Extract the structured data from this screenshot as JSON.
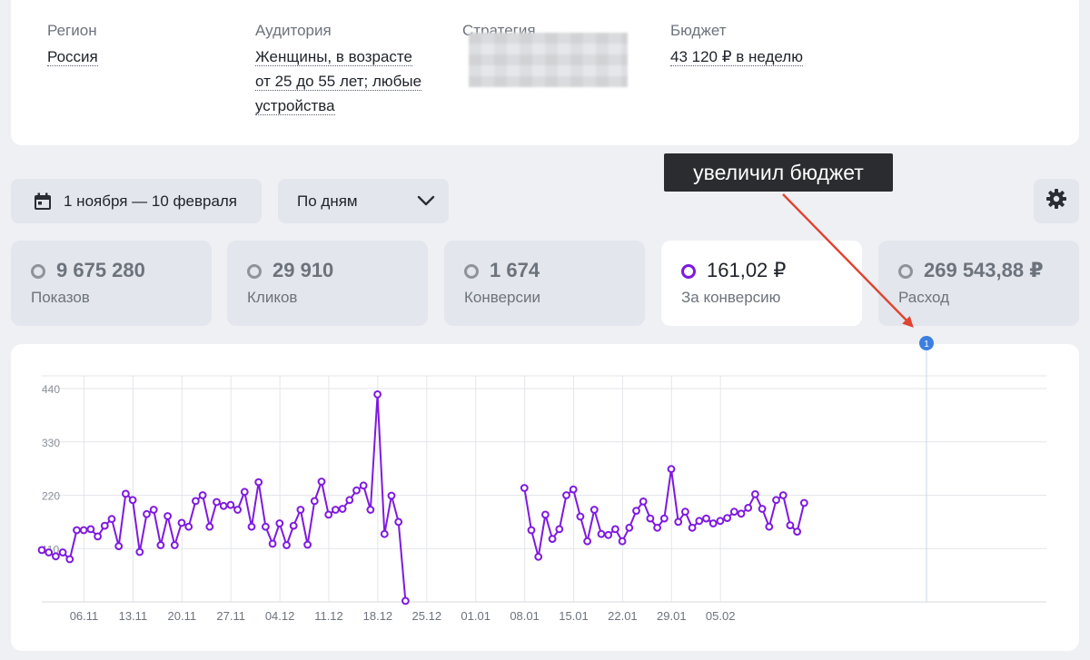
{
  "summary": {
    "region": {
      "label": "Регион",
      "value": "Россия"
    },
    "audience": {
      "label": "Аудитория",
      "lines": [
        "Женщины, в возрасте",
        "от 25 до 55 лет; любые",
        "устройства"
      ]
    },
    "strategy": {
      "label": "Стратегия"
    },
    "budget": {
      "label": "Бюджет",
      "value": "43 120 ₽ в неделю"
    }
  },
  "controls": {
    "period_label": "1 ноября — 10 февраля",
    "grouping_label": "По дням",
    "icons": {
      "period": "calendar-icon",
      "grouping": "chevron-down-icon",
      "settings": "gear-icon"
    }
  },
  "annotation": {
    "text": "увеличил бюджет",
    "marker": "1",
    "colors": {
      "tag": "#2b2c2f",
      "arrow": "#e0432f",
      "marker": "#3d7fe0"
    }
  },
  "kpis": [
    {
      "value": "9 675 280",
      "caption": "Показов",
      "active": false
    },
    {
      "value": "29 910",
      "caption": "Кликов",
      "active": false
    },
    {
      "value": "1 674",
      "caption": "Конверсии",
      "active": false
    },
    {
      "value": "161,02 ₽",
      "caption": "За конверсию",
      "active": true
    },
    {
      "value": "269 543,88 ₽",
      "caption": "Расход",
      "active": false
    }
  ],
  "colors": {
    "accent": "#7f19e0",
    "tile_bg": "#e3e6ec",
    "page_bg": "#eef0f4"
  },
  "chart_data": {
    "type": "line",
    "ylim": [
      0,
      440
    ],
    "yticks": [
      110,
      220,
      330,
      440
    ],
    "x_labels": [
      "06.11",
      "13.11",
      "20.11",
      "27.11",
      "04.12",
      "11.12",
      "18.12",
      "25.12",
      "01.01",
      "08.01",
      "15.01",
      "22.01",
      "29.01",
      "05.02"
    ],
    "first_date": "01.11",
    "annotation_date": "29.01",
    "grid": true,
    "series": [
      {
        "color": "#7f19e0",
        "values": [
          107,
          102,
          94,
          102,
          88,
          148,
          148,
          150,
          135,
          157,
          171,
          115,
          223,
          210,
          103,
          181,
          190,
          117,
          177,
          117,
          163,
          155,
          208,
          220,
          155,
          206,
          198,
          200,
          190,
          227,
          155,
          247,
          155,
          120,
          162,
          117,
          157,
          190,
          118,
          208,
          248,
          180,
          190,
          192,
          210,
          230,
          240,
          190,
          428,
          140,
          219,
          165,
          2,
          null,
          null,
          null,
          null,
          null,
          null,
          null,
          null,
          null,
          null,
          null,
          null,
          null,
          null,
          null,
          null,
          235,
          148,
          93,
          180,
          130,
          150,
          220,
          232,
          176,
          125,
          190,
          140,
          138,
          150,
          125,
          153,
          188,
          207,
          172,
          153,
          172,
          274,
          165,
          186,
          153,
          167,
          172,
          162,
          167,
          173,
          186,
          182,
          194,
          222,
          192,
          155,
          210,
          220,
          158,
          145,
          204
        ]
      }
    ]
  }
}
